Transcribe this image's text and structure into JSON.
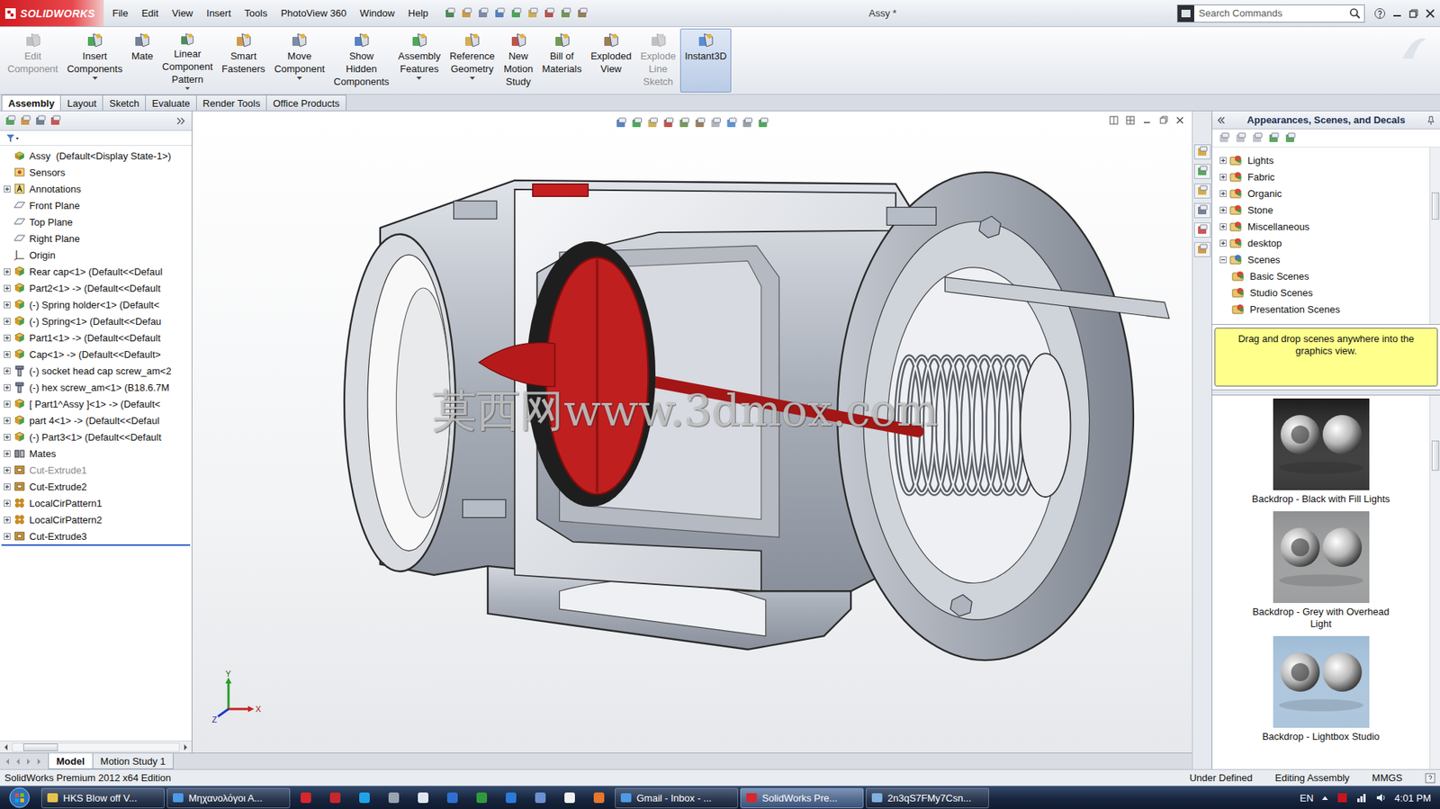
{
  "app": {
    "logo": "SOLIDWORKS"
  },
  "window": {
    "title": "Assy *"
  },
  "menus": [
    "File",
    "Edit",
    "View",
    "Insert",
    "Tools",
    "PhotoView 360",
    "Window",
    "Help"
  ],
  "search": {
    "placeholder": "Search Commands"
  },
  "ribbon": [
    {
      "lines": [
        "Edit",
        "Component"
      ],
      "disabled": true,
      "selected": false,
      "dropdown": false
    },
    {
      "lines": [
        "Insert",
        "Components"
      ],
      "disabled": false,
      "selected": false,
      "dropdown": true
    },
    {
      "lines": [
        "Mate"
      ],
      "disabled": false,
      "selected": false,
      "dropdown": false
    },
    {
      "lines": [
        "Linear",
        "Component",
        "Pattern"
      ],
      "disabled": false,
      "selected": false,
      "dropdown": true
    },
    {
      "lines": [
        "Smart",
        "Fasteners"
      ],
      "disabled": false,
      "selected": false,
      "dropdown": false
    },
    {
      "lines": [
        "Move",
        "Component"
      ],
      "disabled": false,
      "selected": false,
      "dropdown": true
    },
    {
      "lines": [
        "Show",
        "Hidden",
        "Components"
      ],
      "disabled": false,
      "selected": false,
      "dropdown": false
    },
    {
      "lines": [
        "Assembly",
        "Features"
      ],
      "disabled": false,
      "selected": false,
      "dropdown": true
    },
    {
      "lines": [
        "Reference",
        "Geometry"
      ],
      "disabled": false,
      "selected": false,
      "dropdown": true
    },
    {
      "lines": [
        "New",
        "Motion",
        "Study"
      ],
      "disabled": false,
      "selected": false,
      "dropdown": false
    },
    {
      "lines": [
        "Bill of",
        "Materials"
      ],
      "disabled": false,
      "selected": false,
      "dropdown": false
    },
    {
      "lines": [
        "Exploded",
        "View"
      ],
      "disabled": false,
      "selected": false,
      "dropdown": false
    },
    {
      "lines": [
        "Explode",
        "Line",
        "Sketch"
      ],
      "disabled": true,
      "selected": false,
      "dropdown": false
    },
    {
      "lines": [
        "Instant3D"
      ],
      "disabled": false,
      "selected": true,
      "dropdown": false
    }
  ],
  "command_tabs": [
    {
      "label": "Assembly",
      "selected": true
    },
    {
      "label": "Layout",
      "selected": false
    },
    {
      "label": "Sketch",
      "selected": false
    },
    {
      "label": "Evaluate",
      "selected": false
    },
    {
      "label": "Render Tools",
      "selected": false
    },
    {
      "label": "Office Products",
      "selected": false
    }
  ],
  "feature_tree": {
    "items": [
      {
        "label": "Assy  (Default<Display State-1>)",
        "kind": "assy",
        "expandable": false,
        "greyed": false
      },
      {
        "label": "Sensors",
        "kind": "sensors",
        "expandable": false,
        "greyed": false
      },
      {
        "label": "Annotations",
        "kind": "annotations",
        "expandable": true,
        "greyed": false
      },
      {
        "label": "Front Plane",
        "kind": "plane",
        "expandable": false,
        "greyed": false
      },
      {
        "label": "Top Plane",
        "kind": "plane",
        "expandable": false,
        "greyed": false
      },
      {
        "label": "Right Plane",
        "kind": "plane",
        "expandable": false,
        "greyed": false
      },
      {
        "label": "Origin",
        "kind": "origin",
        "expandable": false,
        "greyed": false
      },
      {
        "label": "Rear cap<1> (Default<<Defaul",
        "kind": "part",
        "expandable": true,
        "greyed": false
      },
      {
        "label": "Part2<1> -> (Default<<Default",
        "kind": "part",
        "expandable": true,
        "greyed": false
      },
      {
        "label": "(-) Spring holder<1> (Default<",
        "kind": "part",
        "expandable": true,
        "greyed": false
      },
      {
        "label": "(-) Spring<1> (Default<<Defau",
        "kind": "part",
        "expandable": true,
        "greyed": false
      },
      {
        "label": "Part1<1> -> (Default<<Default",
        "kind": "part",
        "expandable": true,
        "greyed": false
      },
      {
        "label": "Cap<1> -> (Default<<Default>",
        "kind": "part",
        "expandable": true,
        "greyed": false
      },
      {
        "label": "(-) socket head cap screw_am<2",
        "kind": "fastener",
        "expandable": true,
        "greyed": false
      },
      {
        "label": "(-) hex screw_am<1> (B18.6.7M",
        "kind": "fastener",
        "expandable": true,
        "greyed": false
      },
      {
        "label": "[ Part1^Assy ]<1> -> (Default<",
        "kind": "part",
        "expandable": true,
        "greyed": false
      },
      {
        "label": "part 4<1> -> (Default<<Defaul",
        "kind": "part",
        "expandable": true,
        "greyed": false
      },
      {
        "label": "(-) Part3<1> (Default<<Default",
        "kind": "part",
        "expandable": true,
        "greyed": false
      },
      {
        "label": "Mates",
        "kind": "mates",
        "expandable": true,
        "greyed": false
      },
      {
        "label": "Cut-Extrude1",
        "kind": "feature",
        "expandable": true,
        "greyed": true
      },
      {
        "label": "Cut-Extrude2",
        "kind": "feature",
        "expandable": true,
        "greyed": false
      },
      {
        "label": "LocalCirPattern1",
        "kind": "pattern",
        "expandable": true,
        "greyed": false
      },
      {
        "label": "LocalCirPattern2",
        "kind": "pattern",
        "expandable": true,
        "greyed": false
      },
      {
        "label": "Cut-Extrude3",
        "kind": "feature",
        "expandable": true,
        "greyed": false
      }
    ]
  },
  "bottom_tabs": [
    {
      "label": "Model",
      "selected": true
    },
    {
      "label": "Motion Study 1",
      "selected": false
    }
  ],
  "task_pane": {
    "title": "Appearances, Scenes, and Decals",
    "tree": [
      {
        "label": "Lights",
        "kind": "folder",
        "expanded": false
      },
      {
        "label": "Fabric",
        "kind": "folder",
        "expanded": false
      },
      {
        "label": "Organic",
        "kind": "folder",
        "expanded": false
      },
      {
        "label": "Stone",
        "kind": "folder",
        "expanded": false
      },
      {
        "label": "Miscellaneous",
        "kind": "folder",
        "expanded": false
      },
      {
        "label": "desktop",
        "kind": "folder",
        "expanded": false
      },
      {
        "label": "Scenes",
        "kind": "root",
        "expanded": true
      },
      {
        "label": "Basic Scenes",
        "kind": "child",
        "expanded": false
      },
      {
        "label": "Studio Scenes",
        "kind": "child",
        "expanded": false
      },
      {
        "label": "Presentation Scenes",
        "kind": "child",
        "expanded": false
      }
    ],
    "tip": "Drag and drop scenes anywhere into the graphics view.",
    "thumbnails": [
      {
        "label": "Backdrop - Black with Fill Lights",
        "color": "#1c1c1c"
      },
      {
        "label": "Backdrop - Grey with Overhead Light",
        "color": "#8f9091"
      },
      {
        "label": "Backdrop - Lightbox Studio",
        "color": "#9fbcd6"
      }
    ]
  },
  "watermark": "莫西网www.3dmox.com",
  "triad": {
    "x": "X",
    "y": "Y",
    "z": "Z"
  },
  "status_bar": {
    "edition": "SolidWorks Premium 2012 x64 Edition",
    "items": [
      "Under Defined",
      "Editing Assembly",
      "MMGS"
    ]
  },
  "taskbar": {
    "items": [
      {
        "kind": "task",
        "label": "HKS Blow off V...",
        "selected": false,
        "color": "#e8c34a"
      },
      {
        "kind": "task",
        "label": "Μηχανολόγοι Α...",
        "selected": false,
        "color": "#4a9be8"
      },
      {
        "kind": "pinned",
        "label": "",
        "selected": false,
        "color": "#d8262d"
      },
      {
        "kind": "pinned",
        "label": "",
        "selected": false,
        "color": "#c9262d"
      },
      {
        "kind": "pinned",
        "label": "",
        "selected": false,
        "color": "#1fa3e8"
      },
      {
        "kind": "pinned",
        "label": "",
        "selected": false,
        "color": "#9aa4b0"
      },
      {
        "kind": "pinned",
        "label": "",
        "selected": false,
        "color": "#dfe6ee"
      },
      {
        "kind": "pinned",
        "label": "",
        "selected": false,
        "color": "#2f6fd1"
      },
      {
        "kind": "pinned",
        "label": "",
        "selected": false,
        "color": "#2f9a3c"
      },
      {
        "kind": "pinned",
        "label": "",
        "selected": false,
        "color": "#2b7ad8"
      },
      {
        "kind": "pinned",
        "label": "",
        "selected": false,
        "color": "#6b8fd0"
      },
      {
        "kind": "pinned",
        "label": "",
        "selected": false,
        "color": "#f0f0f0"
      },
      {
        "kind": "pinned",
        "label": "",
        "selected": false,
        "color": "#e8772a"
      },
      {
        "kind": "task",
        "label": "Gmail - Inbox - ...",
        "selected": false,
        "color": "#4a9be8"
      },
      {
        "kind": "task",
        "label": "SolidWorks Pre...",
        "selected": true,
        "color": "#d8262d"
      },
      {
        "kind": "task",
        "label": "2n3qS7FMy7Csn...",
        "selected": false,
        "color": "#7fb0e0"
      }
    ],
    "language": "EN",
    "time": "4:01 PM"
  }
}
